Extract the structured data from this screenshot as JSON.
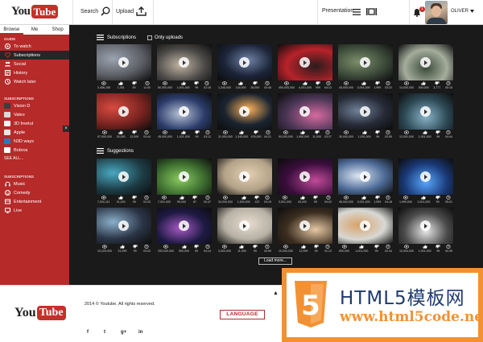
{
  "header": {
    "logo_you": "You",
    "logo_tube": "Tube",
    "search_label": "Search",
    "upload_label": "Upload",
    "presentation_label": "Presentation",
    "notification_count": "1",
    "username": "OLIVER"
  },
  "sidebar": {
    "tabs": [
      "Browse",
      "Me",
      "Shop"
    ],
    "guide_title": "GUIDE",
    "guide_items": [
      "To watch",
      "Subscriptions",
      "Social",
      "History",
      "Watch later"
    ],
    "subs_title": "SUBSCRIPTIONS",
    "subs_items": [
      "Vision D",
      "Valeo",
      "3D freetut",
      "Apple",
      "N3D ways",
      "Bobros"
    ],
    "see_more": "SEE ALL...",
    "subs2_title": "SUBSCRIPTIONS",
    "subs2_items": [
      "Music",
      "Comedy",
      "Entertainment",
      "Live"
    ]
  },
  "main": {
    "subscriptions_title": "Subscriptions",
    "only_uploads_label": "Only uploads",
    "suggestions_title": "Suggestions",
    "load_more": "Load more...",
    "rows": [
      [
        {
          "views": "3,456,155",
          "likes": "1,001",
          "dislikes": "99",
          "time": "11:00"
        },
        {
          "views": "50,000,000",
          "likes": "1,001,000",
          "dislikes": "99",
          "time": "02:18"
        },
        {
          "views": "1,245,000",
          "likes": "144,000",
          "dislikes": "26,000",
          "time": "03:45"
        },
        {
          "views": "450,000,000",
          "likes": "4,001,000",
          "dislikes": "999",
          "time": "04:12"
        },
        {
          "views": "45,000,000",
          "likes": "3,001,000",
          "dislikes": "1,999",
          "time": "03:22"
        },
        {
          "views": "14,000,000",
          "likes": "300,000",
          "dislikes": "3,777",
          "time": "05:15"
        }
      ],
      [
        {
          "views": "97,000,000",
          "likes": "30,000",
          "dislikes": "12,000",
          "time": "03:44"
        },
        {
          "views": "45,000,000",
          "likes": "1,021,000",
          "dislikes": "99",
          "time": "03:11"
        },
        {
          "views": "11,000,000",
          "likes": "1,345,000",
          "dislikes": "476,000",
          "time": "04:21"
        },
        {
          "views": "90,000,000",
          "likes": "1,900,000",
          "dislikes": "11,000",
          "time": "03:37"
        },
        {
          "views": "30,000,000",
          "likes": "1,001,000",
          "dislikes": "99",
          "time": "02:55"
        },
        {
          "views": "12,001,000",
          "likes": "1,001,000",
          "dislikes": "99",
          "time": "04:44"
        }
      ],
      [
        {
          "views": "7,000,111",
          "likes": "31,000",
          "dislikes": "99",
          "time": "03:33"
        },
        {
          "views": "7,001,000",
          "likes": "99,000",
          "dislikes": "87",
          "time": "00:47"
        },
        {
          "views": "34,000,000",
          "likes": "1,300,000",
          "dislikes": "123",
          "time": "03:19"
        },
        {
          "views": "3,001,000",
          "likes": "43,000",
          "dislikes": "99",
          "time": "04:02"
        },
        {
          "views": "45,000,000",
          "likes": "3,001,000",
          "dislikes": "1,999",
          "time": "04:18"
        },
        {
          "views": "1,999,000",
          "likes": "1,001,000",
          "dislikes": "99",
          "time": "05:01"
        }
      ],
      [
        {
          "views": "10,225,000",
          "likes": "31,999",
          "dislikes": "99",
          "time": "03:03"
        },
        {
          "views": "200,000,000",
          "likes": "500,000",
          "dislikes": "99",
          "time": "04:14"
        },
        {
          "views": "3,000,000",
          "likes": "11,000",
          "dislikes": "99",
          "time": "00:59"
        },
        {
          "views": "10,000,000",
          "likes": "12,999",
          "dislikes": "99",
          "time": "01:12"
        },
        {
          "views": "600,000",
          "likes": "1,001,000",
          "dislikes": "99",
          "time": "02:44"
        },
        {
          "views": "10,000,000",
          "likes": "1,001,000",
          "dislikes": "99",
          "time": "00:35"
        }
      ]
    ],
    "thumb_colors": [
      [
        "#5d5f66",
        "#4c4a48",
        "#1c2438",
        "#b8222a",
        "#3c4a3a",
        "#a5ad9c"
      ],
      [
        "#7a2420",
        "#2b3c6a",
        "#1a2430",
        "#4a3656",
        "#262a36",
        "#2d4a56"
      ],
      [
        "#1d3d46",
        "#3b6a2e",
        "#b3a288",
        "#3a0e3c",
        "#4c6a96",
        "#1a3a78"
      ],
      [
        "#2b3446",
        "#1e1a44",
        "#b7b0a4",
        "#3c2e20",
        "#d8d8d4",
        "#4c4c4c"
      ]
    ],
    "thumb_accents": [
      [
        "#9aa3b0",
        "#c2b6a4",
        "#6f82a6",
        "#2b1c1c",
        "#7d8f6a",
        "#3a4a3a"
      ],
      [
        "#d74b40",
        "#b8c4d8",
        "#ffb35a",
        "#d76aa0",
        "#70829a",
        "#8ab4c8"
      ],
      [
        "#4aa8c0",
        "#8acc60",
        "#e4cfb2",
        "#c24a9a",
        "#dce6f4",
        "#58a8ff"
      ],
      [
        "#8ab0ca",
        "#a85ac4",
        "#e8ddd0",
        "#e6c8a4",
        "#d8a26a",
        "#e8e8e8"
      ]
    ]
  },
  "footer": {
    "logo_you": "You",
    "logo_tube": "Tube",
    "copyright": "2014 © Youtube. All rights reserved.",
    "language": "LANGUAGE",
    "social": [
      "f",
      "t",
      "g+",
      "in"
    ]
  },
  "watermark": {
    "title": "HTML5模板网",
    "url": "www.html5code.net",
    "shield_digit": "5"
  },
  "colors": {
    "brand_red": "#b62a2a",
    "dark_bg": "#1a1a1a",
    "watermark_orange": "#f29133"
  }
}
